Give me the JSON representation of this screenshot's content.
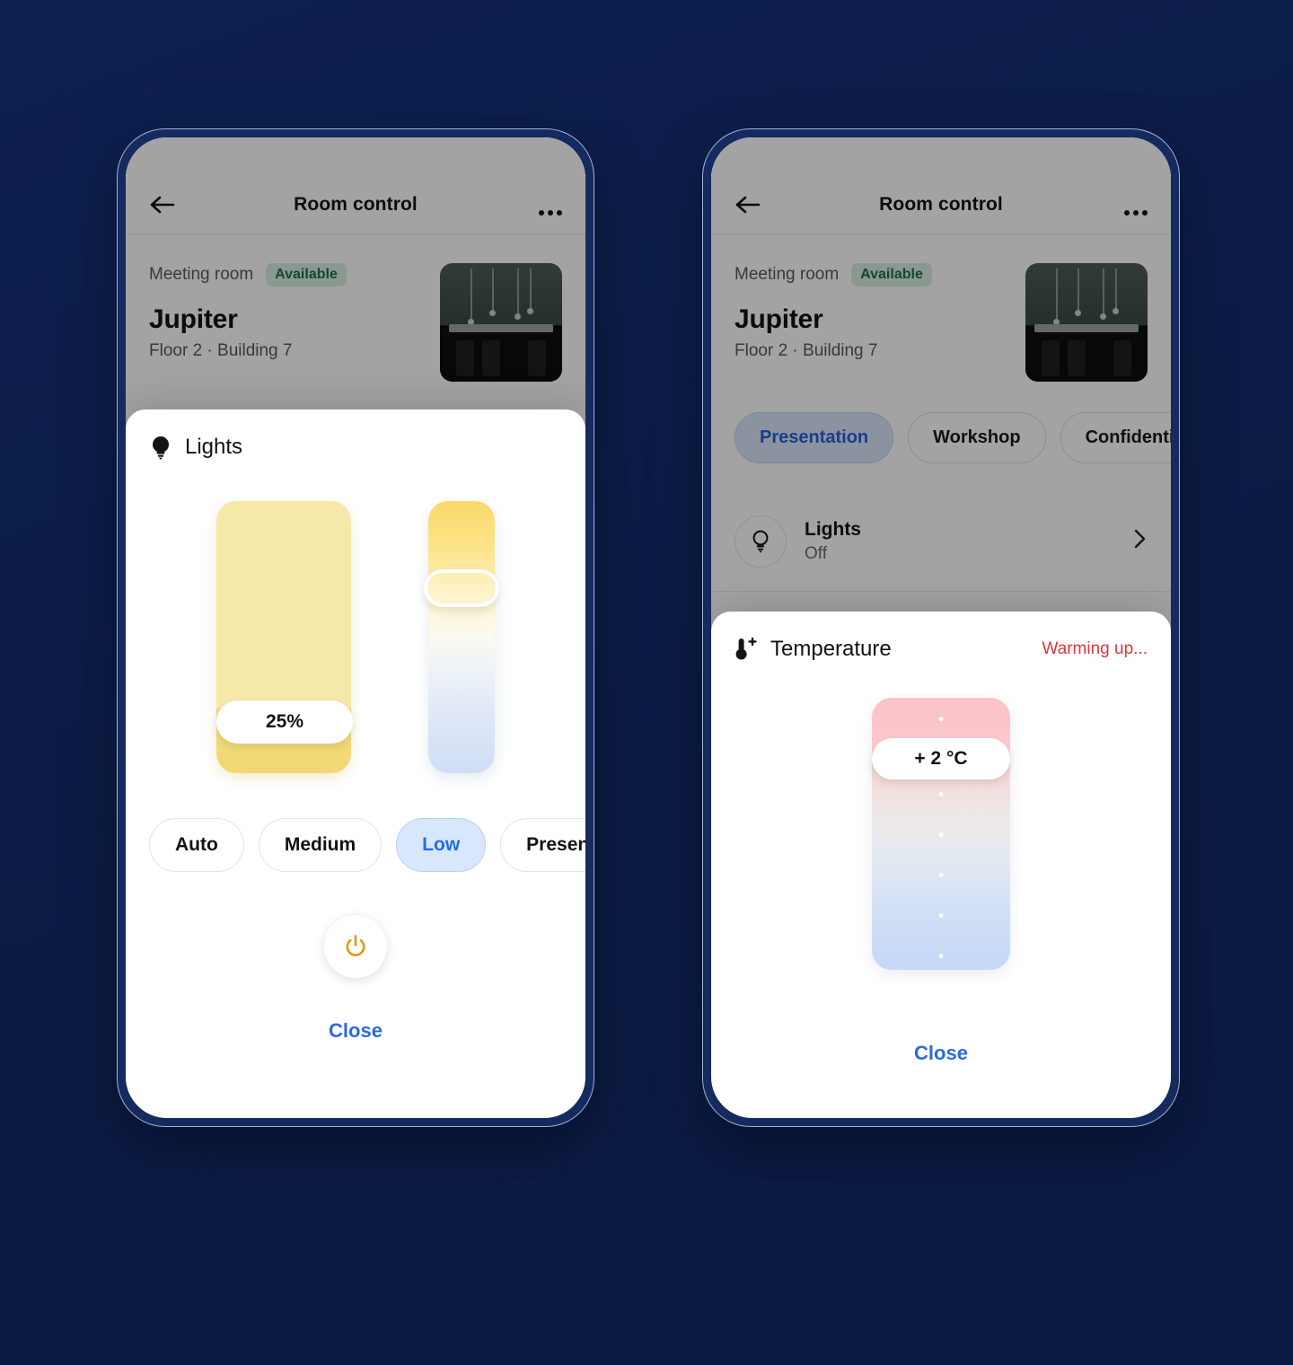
{
  "background_color": "#0c1d4a",
  "phones": [
    {
      "id": "left",
      "nav": {
        "back_icon": "arrow-left-icon",
        "title": "Room control",
        "more_icon": "ellipsis-icon"
      },
      "room": {
        "kind": "Meeting room",
        "status": "Available",
        "status_color": "#1f6f4f",
        "name": "Jupiter",
        "location": "Floor 2 · Building 7",
        "thumbnail": "meeting-room-photo"
      },
      "sheet": {
        "type": "lights",
        "icon": "lightbulb-filled-icon",
        "title": "Lights",
        "brightness": {
          "value": "25%",
          "percent": 25
        },
        "color_temp": {
          "thumb_position_percent": 25
        },
        "presets": [
          {
            "label": "Auto",
            "active": false
          },
          {
            "label": "Medium",
            "active": false
          },
          {
            "label": "Low",
            "active": true
          },
          {
            "label": "Presentation",
            "active": false
          }
        ],
        "active_preset_color": "#1f6fe5",
        "power_icon": "power-icon",
        "power_color": "#e8930c",
        "close_label": "Close",
        "close_color": "#2a6ae0"
      }
    },
    {
      "id": "right",
      "nav": {
        "back_icon": "arrow-left-icon",
        "title": "Room control",
        "more_icon": "ellipsis-icon"
      },
      "room": {
        "kind": "Meeting room",
        "status": "Available",
        "status_color": "#1f6f4f",
        "name": "Jupiter",
        "location": "Floor 2 · Building 7",
        "thumbnail": "meeting-room-photo"
      },
      "scenes": [
        {
          "label": "Presentation",
          "active": true
        },
        {
          "label": "Workshop",
          "active": false
        },
        {
          "label": "Confidential",
          "active": false
        }
      ],
      "devices": [
        {
          "icon": "lightbulb-outline-icon",
          "title": "Lights",
          "state": "Off",
          "chevron": "chevron-right-icon"
        }
      ],
      "sheet": {
        "type": "temperature",
        "icon": "thermometer-plus-icon",
        "title": "Temperature",
        "status": "Warming up...",
        "status_color": "#e0353b",
        "value": "+ 2 °C",
        "thumb_position_percent": 15,
        "tick_count": 6,
        "close_label": "Close",
        "close_color": "#2a6ae0"
      }
    }
  ]
}
